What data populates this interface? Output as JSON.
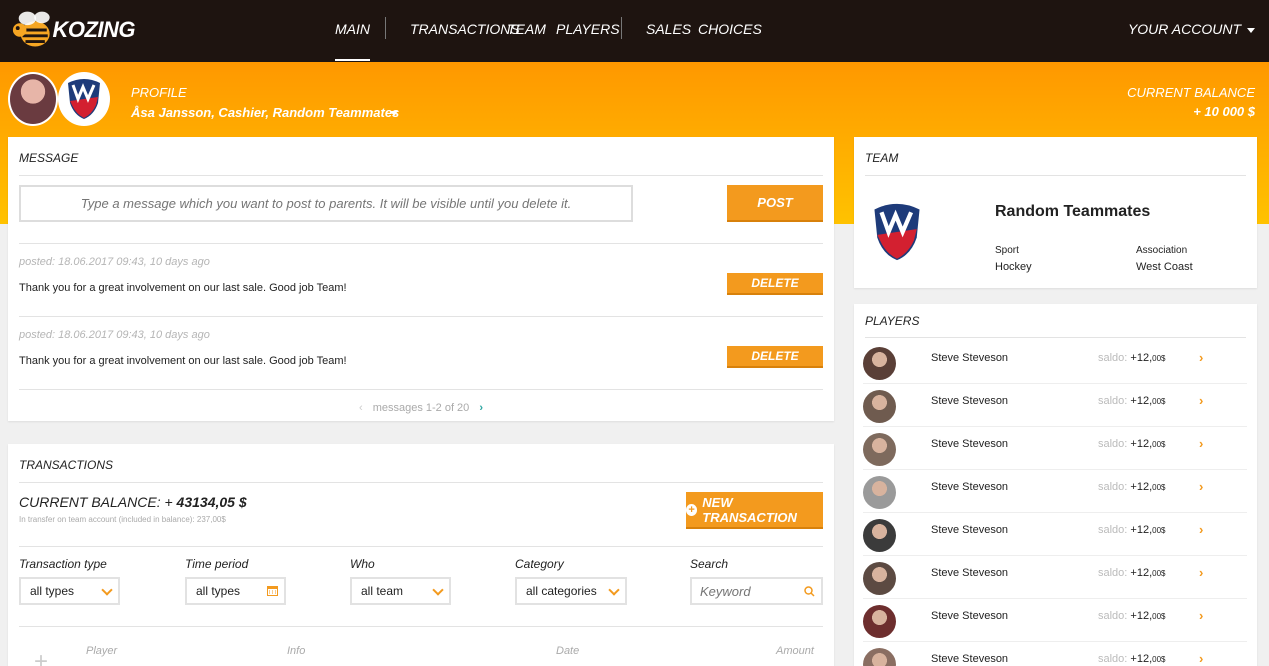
{
  "brand": {
    "name": "KOZING"
  },
  "nav": {
    "items": [
      {
        "label": "MAIN"
      },
      {
        "label": "TRANSACTIONS"
      },
      {
        "label": "TEAM"
      },
      {
        "label": "PLAYERS"
      },
      {
        "label": "SALES"
      },
      {
        "label": "CHOICES"
      }
    ],
    "account": "YOUR ACCOUNT"
  },
  "profile": {
    "label": "PROFILE",
    "name": "Åsa Jansson, Cashier, Random Teammates",
    "balance_label": "CURRENT BALANCE",
    "balance_value": "+ 10 000 $"
  },
  "message": {
    "title": "MESSAGE",
    "placeholder": "Type a message which you want to post to parents. It will be visible until you delete it.",
    "post_label": "POST",
    "posts": [
      {
        "meta": "posted: 18.06.2017 09:43, 10 days ago",
        "text": "Thank you for a great involvement on our last sale. Good job Team!",
        "delete_label": "DELETE"
      },
      {
        "meta": "posted: 18.06.2017 09:43, 10 days ago",
        "text": "Thank you for a great involvement on our last sale. Good job Team!",
        "delete_label": "DELETE"
      }
    ],
    "pager": "messages 1-2 of 20"
  },
  "transactions": {
    "title": "TRANSACTIONS",
    "balance_label": "CURRENT BALANCE: +",
    "balance_value": "43134,05 $",
    "sub": "In transfer on team account (included in balance): 237,00$",
    "new_label": "NEW TRANSACTION",
    "filters": {
      "type_label": "Transaction type",
      "type_value": "all types",
      "period_label": "Time period",
      "period_value": "all types",
      "who_label": "Who",
      "who_value": "all team",
      "category_label": "Category",
      "category_value": "all categories",
      "search_label": "Search",
      "search_placeholder": "Keyword"
    },
    "columns": {
      "player": "Player",
      "info": "Info",
      "date": "Date",
      "amount": "Amount"
    }
  },
  "team": {
    "title": "TEAM",
    "name": "Random Teammates",
    "sport_label": "Sport",
    "sport_value": "Hockey",
    "association_label": "Association",
    "association_value": "West Coast"
  },
  "players": {
    "title": "PLAYERS",
    "saldo_label": "saldo:",
    "list": [
      {
        "name": "Steve Steveson",
        "saldo": "+12,",
        "cents": "00$"
      },
      {
        "name": "Steve Steveson",
        "saldo": "+12,",
        "cents": "00$"
      },
      {
        "name": "Steve Steveson",
        "saldo": "+12,",
        "cents": "00$"
      },
      {
        "name": "Steve Steveson",
        "saldo": "+12,",
        "cents": "00$"
      },
      {
        "name": "Steve Steveson",
        "saldo": "+12,",
        "cents": "00$"
      },
      {
        "name": "Steve Steveson",
        "saldo": "+12,",
        "cents": "00$"
      },
      {
        "name": "Steve Steveson",
        "saldo": "+12,",
        "cents": "00$"
      },
      {
        "name": "Steve Steveson",
        "saldo": "+12,",
        "cents": "00$"
      }
    ]
  },
  "colors": {
    "accent": "#f39a1e",
    "topbar": "#1e1410",
    "band_top": "#ff9800",
    "band_bottom": "#ffc200"
  }
}
